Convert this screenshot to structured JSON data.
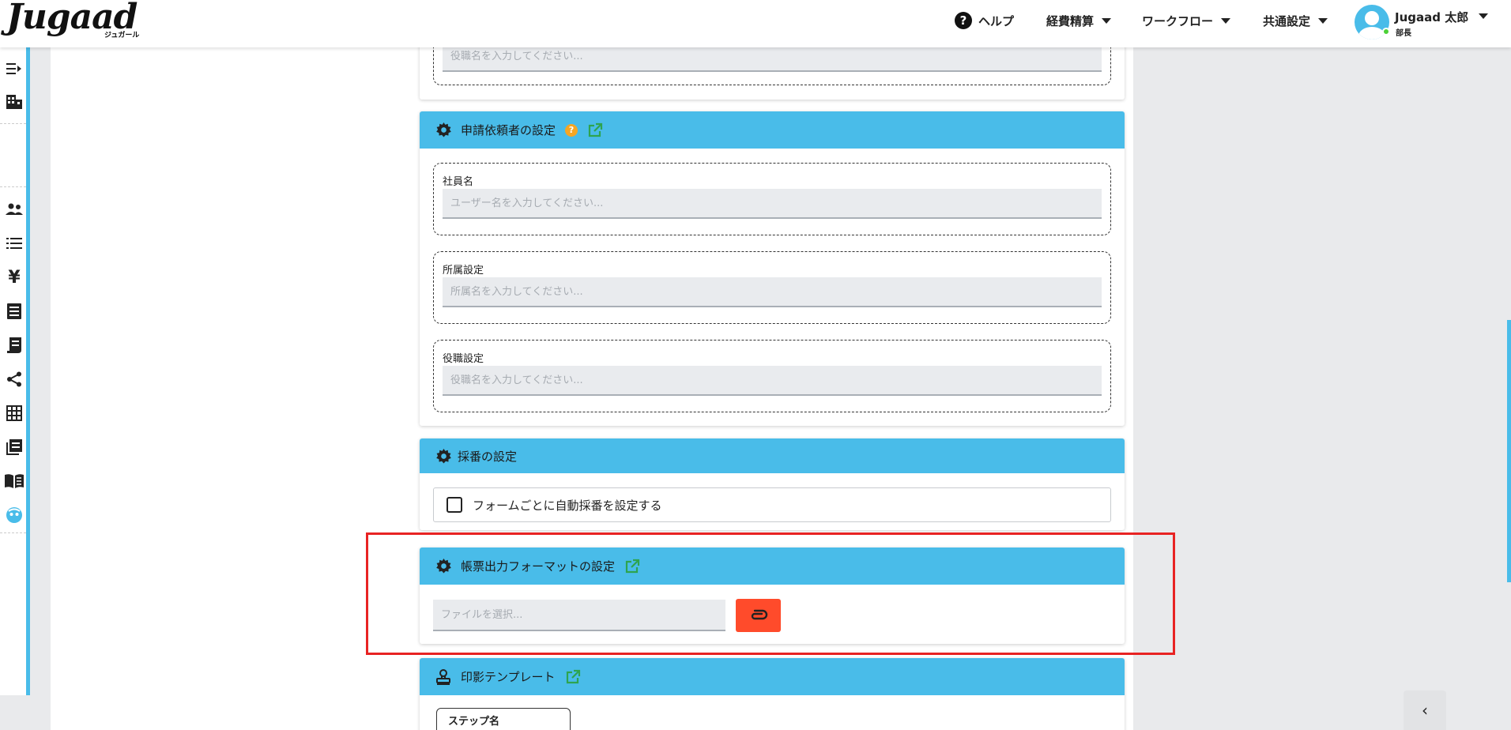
{
  "header": {
    "logo_text": "Jugaad",
    "logo_sub": "ジュガール",
    "help_label": "ヘルプ",
    "menus": [
      {
        "label": "経費精算"
      },
      {
        "label": "ワークフロー"
      },
      {
        "label": "共通設定"
      }
    ],
    "user_name": "Jugaad 太郎",
    "user_role": "部長"
  },
  "sidebar": {
    "icons": [
      "menu-expand-icon",
      "building-icon",
      "users-icon",
      "list-icon",
      "yen-icon",
      "receipt-icon",
      "invoice-icon",
      "share-icon",
      "table-icon",
      "library-icon",
      "book-icon",
      "face-icon"
    ]
  },
  "top_card": {
    "placeholder": "役職名を入力してください..."
  },
  "requester_card": {
    "title": "申請依頼者の設定",
    "fields": [
      {
        "label": "社員名",
        "placeholder": "ユーザー名を入力してください..."
      },
      {
        "label": "所属設定",
        "placeholder": "所属名を入力してください..."
      },
      {
        "label": "役職設定",
        "placeholder": "役職名を入力してください..."
      }
    ]
  },
  "numbering_card": {
    "title": "採番の設定",
    "checkbox_label": "フォームごとに自動採番を設定する"
  },
  "output_format_card": {
    "title": "帳票出力フォーマットの設定",
    "file_placeholder": "ファイルを選択..."
  },
  "seal_card": {
    "title": "印影テンプレート",
    "column_header": "ステップ名"
  },
  "colors": {
    "accent": "#49bce9",
    "attach_button": "#ff4b2b",
    "highlight": "#e82323",
    "external_link": "#2ea44f",
    "help_badge": "#f5a623"
  }
}
